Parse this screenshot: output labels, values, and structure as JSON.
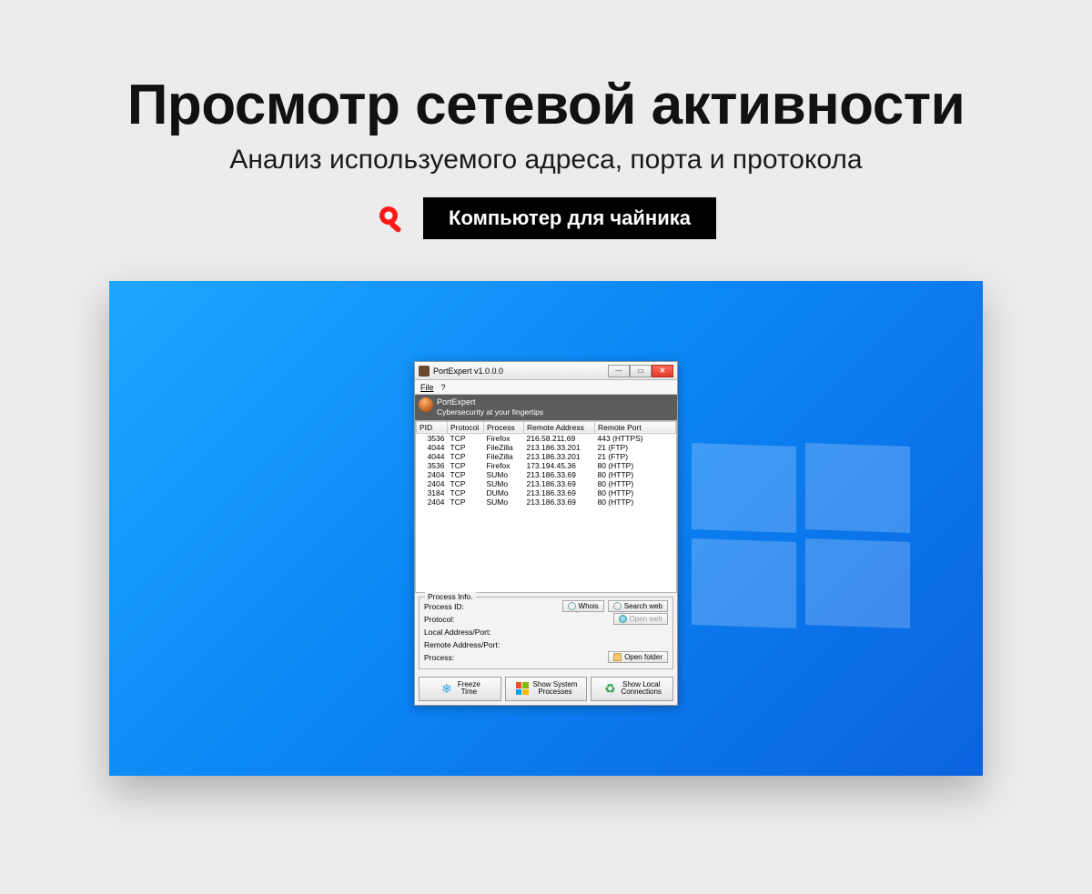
{
  "headline": "Просмотр сетевой активности",
  "subhead": "Анализ используемого адреса, порта и протокола",
  "brand_button": "Компьютер для чайника",
  "app": {
    "title": "PortExpert v1.0.0.0",
    "menu": {
      "file": "File",
      "help": "?"
    },
    "banner": {
      "name": "PortExpert",
      "tagline": "Cybersecurity at your fingertips"
    },
    "columns": [
      "PID",
      "Protocol",
      "Process",
      "Remote Address",
      "Remote Port"
    ],
    "rows": [
      {
        "pid": "3536",
        "protocol": "TCP",
        "process": "Firefox",
        "addr": "216.58.211.69",
        "port": "443 (HTTPS)"
      },
      {
        "pid": "4044",
        "protocol": "TCP",
        "process": "FileZilla",
        "addr": "213.186.33.201",
        "port": "21 (FTP)"
      },
      {
        "pid": "4044",
        "protocol": "TCP",
        "process": "FileZilla",
        "addr": "213.186.33.201",
        "port": "21 (FTP)"
      },
      {
        "pid": "3536",
        "protocol": "TCP",
        "process": "Firefox",
        "addr": "173.194.45.36",
        "port": "80 (HTTP)"
      },
      {
        "pid": "2404",
        "protocol": "TCP",
        "process": "SUMo",
        "addr": "213.186.33.69",
        "port": "80 (HTTP)"
      },
      {
        "pid": "2404",
        "protocol": "TCP",
        "process": "SUMo",
        "addr": "213.186.33.69",
        "port": "80 (HTTP)"
      },
      {
        "pid": "3184",
        "protocol": "TCP",
        "process": "DUMo",
        "addr": "213.186.33.69",
        "port": "80 (HTTP)"
      },
      {
        "pid": "2404",
        "protocol": "TCP",
        "process": "SUMo",
        "addr": "213.186.33.69",
        "port": "80 (HTTP)"
      }
    ],
    "process_info": {
      "legend": "Process Info.",
      "process_id": "Process ID:",
      "protocol": "Protocol:",
      "local": "Local Address/Port:",
      "remote": "Remote Address/Port:",
      "process": "Process:"
    },
    "buttons": {
      "whois": "Whois",
      "search_web": "Search web",
      "open_web": "Open web",
      "open_folder": "Open folder",
      "freeze": "Freeze\nTime",
      "show_system": "Show System\nProcesses",
      "show_local": "Show Local\nConnections"
    }
  }
}
